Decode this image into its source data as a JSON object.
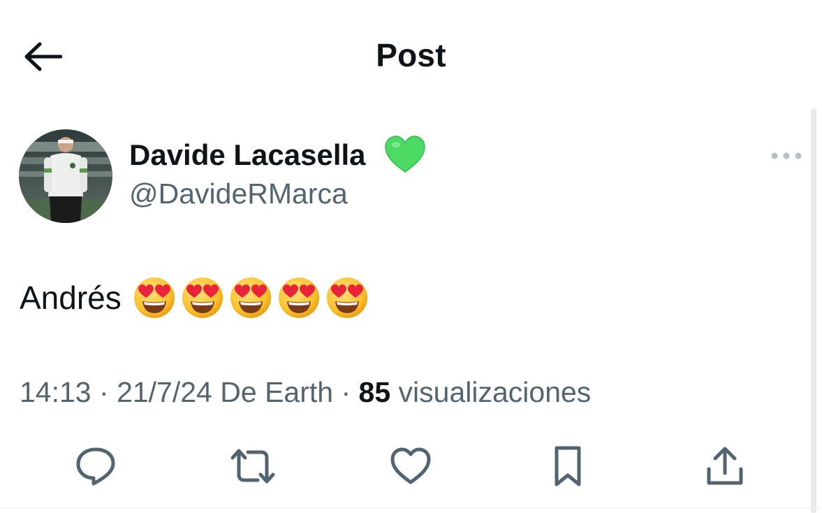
{
  "header": {
    "title": "Post",
    "back_icon": "arrow-left-icon"
  },
  "post": {
    "author": {
      "display_name": "Davide Lacasella",
      "badge_emoji": "green-heart",
      "handle": "@DavideRMarca"
    },
    "text": "Andrés",
    "emojis": [
      "heart-eyes",
      "heart-eyes",
      "heart-eyes",
      "heart-eyes",
      "heart-eyes"
    ],
    "meta": {
      "time": "14:13",
      "date": "21/7/24",
      "source": "De Earth",
      "views_count": "85",
      "views_label": "visualizaciones"
    }
  },
  "actions": [
    {
      "name": "reply",
      "icon": "speech-bubble-icon"
    },
    {
      "name": "repost",
      "icon": "repost-arrows-icon"
    },
    {
      "name": "like",
      "icon": "heart-outline-icon"
    },
    {
      "name": "bookmark",
      "icon": "bookmark-icon"
    },
    {
      "name": "share",
      "icon": "share-upload-icon"
    }
  ],
  "colors": {
    "text_primary": "#0f1419",
    "text_secondary": "#536471",
    "icon_gray": "#536471",
    "badge_green": "#4cd964"
  }
}
